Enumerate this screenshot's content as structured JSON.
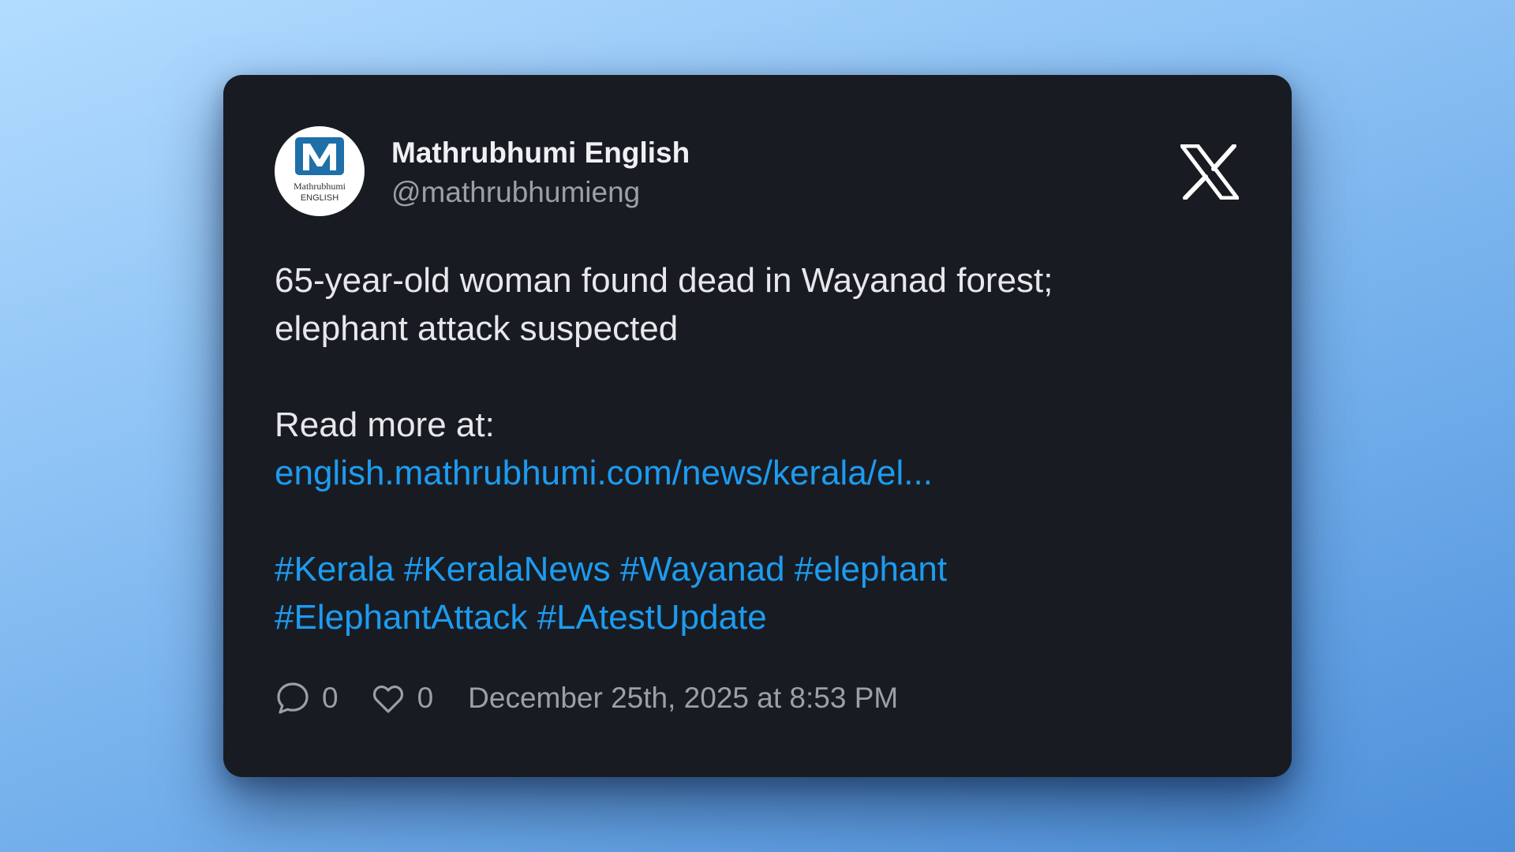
{
  "tweet": {
    "author": {
      "name": "Mathrubhumi English",
      "handle": "@mathrubhumieng",
      "avatar_icon": "mathrubhumi-logo",
      "avatar_text_lines": [
        "Mathrubhumi",
        "ENGLISH"
      ]
    },
    "platform_icon": "x-logo-icon",
    "text_lines": [
      "65-year-old woman found dead in Wayanad forest;",
      "elephant attack suspected"
    ],
    "read_more_label": "Read more at:",
    "link": "english.mathrubhumi.com/news/kerala/el...",
    "hashtag_lines": [
      [
        "#Kerala",
        "#KeralaNews",
        "#Wayanad",
        "#elephant"
      ],
      [
        "#ElephantAttack",
        "#LAtestUpdate"
      ]
    ],
    "replies": "0",
    "likes": "0",
    "timestamp": "December 25th, 2025 at 8:53 PM"
  },
  "colors": {
    "card_bg": "#181c22",
    "link": "#1d9bf0",
    "text": "#e6e8eb",
    "muted": "#9aa0a8",
    "logo_blue": "#1f6fa8"
  }
}
